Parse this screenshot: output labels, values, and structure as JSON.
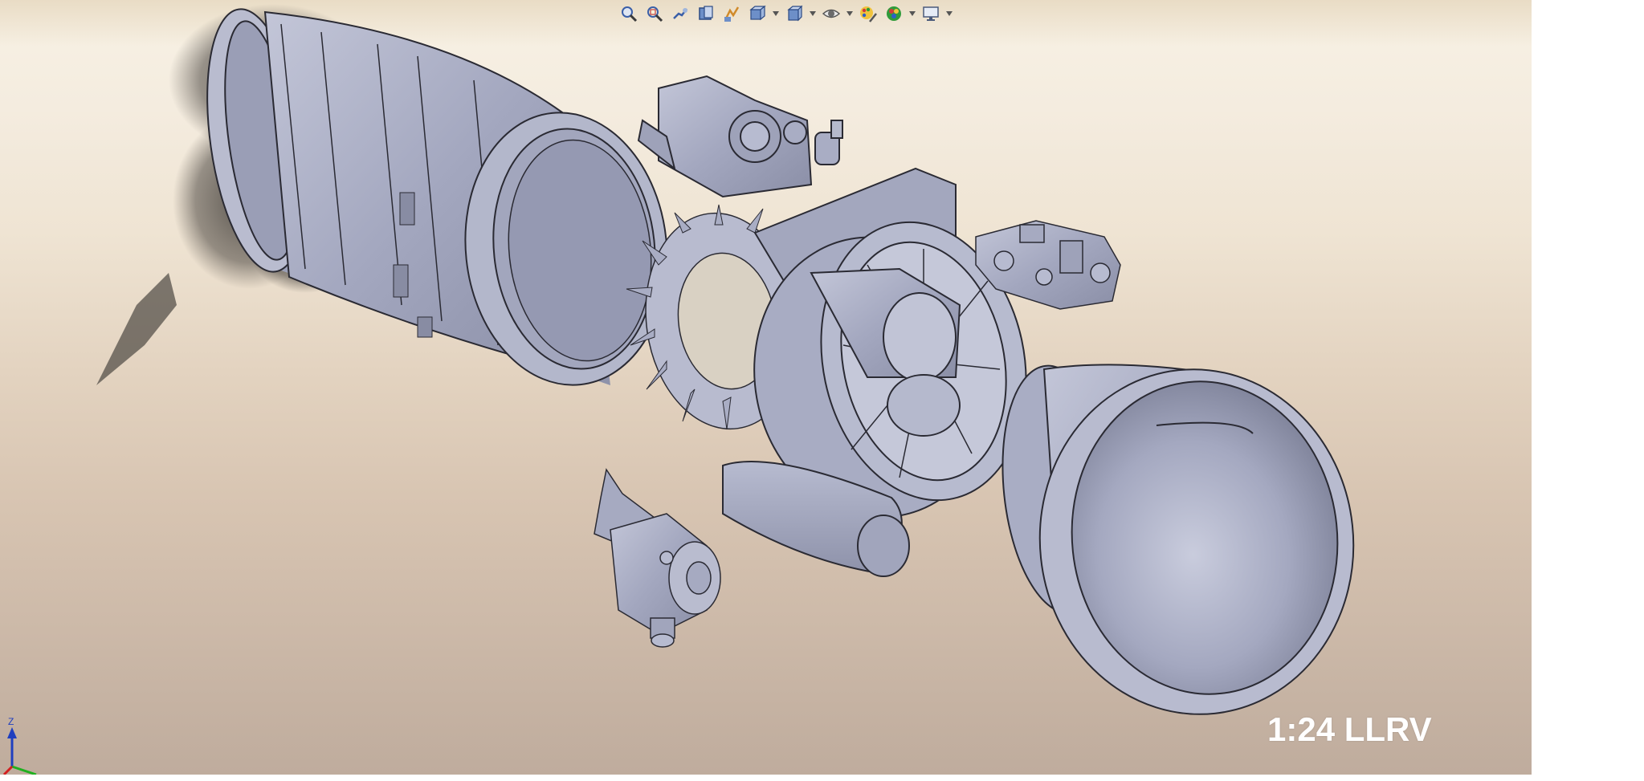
{
  "toolbar": {
    "items": [
      {
        "icon": "zoom-to-fit-icon",
        "dropdown": false
      },
      {
        "icon": "zoom-to-area-icon",
        "dropdown": false
      },
      {
        "icon": "previous-view-icon",
        "dropdown": false
      },
      {
        "icon": "section-view-icon",
        "dropdown": false
      },
      {
        "icon": "dynamic-annotation-icon",
        "dropdown": false
      },
      {
        "icon": "view-orientation-icon",
        "dropdown": true
      },
      {
        "icon": "display-style-icon",
        "dropdown": true
      },
      {
        "icon": "hide-show-items-icon",
        "dropdown": true
      },
      {
        "icon": "edit-appearance-icon",
        "dropdown": false
      },
      {
        "icon": "apply-scene-icon",
        "dropdown": true
      },
      {
        "icon": "view-settings-icon",
        "dropdown": true
      }
    ]
  },
  "model": {
    "scale_label": "1:24 LLRV",
    "parts": [
      "outer-casing",
      "gearbox-housing",
      "compressor-disc",
      "engine-core",
      "fuel-control-unit",
      "starter-motor",
      "intake-bellmouth"
    ]
  },
  "triad": {
    "axis_z": "Z",
    "colors": {
      "z": "#1f3fbf",
      "x": "#d22020",
      "y": "#20b020"
    }
  },
  "colors": {
    "part_fill": "#a9adc4",
    "part_edge": "#2a2a33",
    "background_top": "#f6efe2",
    "background_bottom": "#bfac9d"
  }
}
